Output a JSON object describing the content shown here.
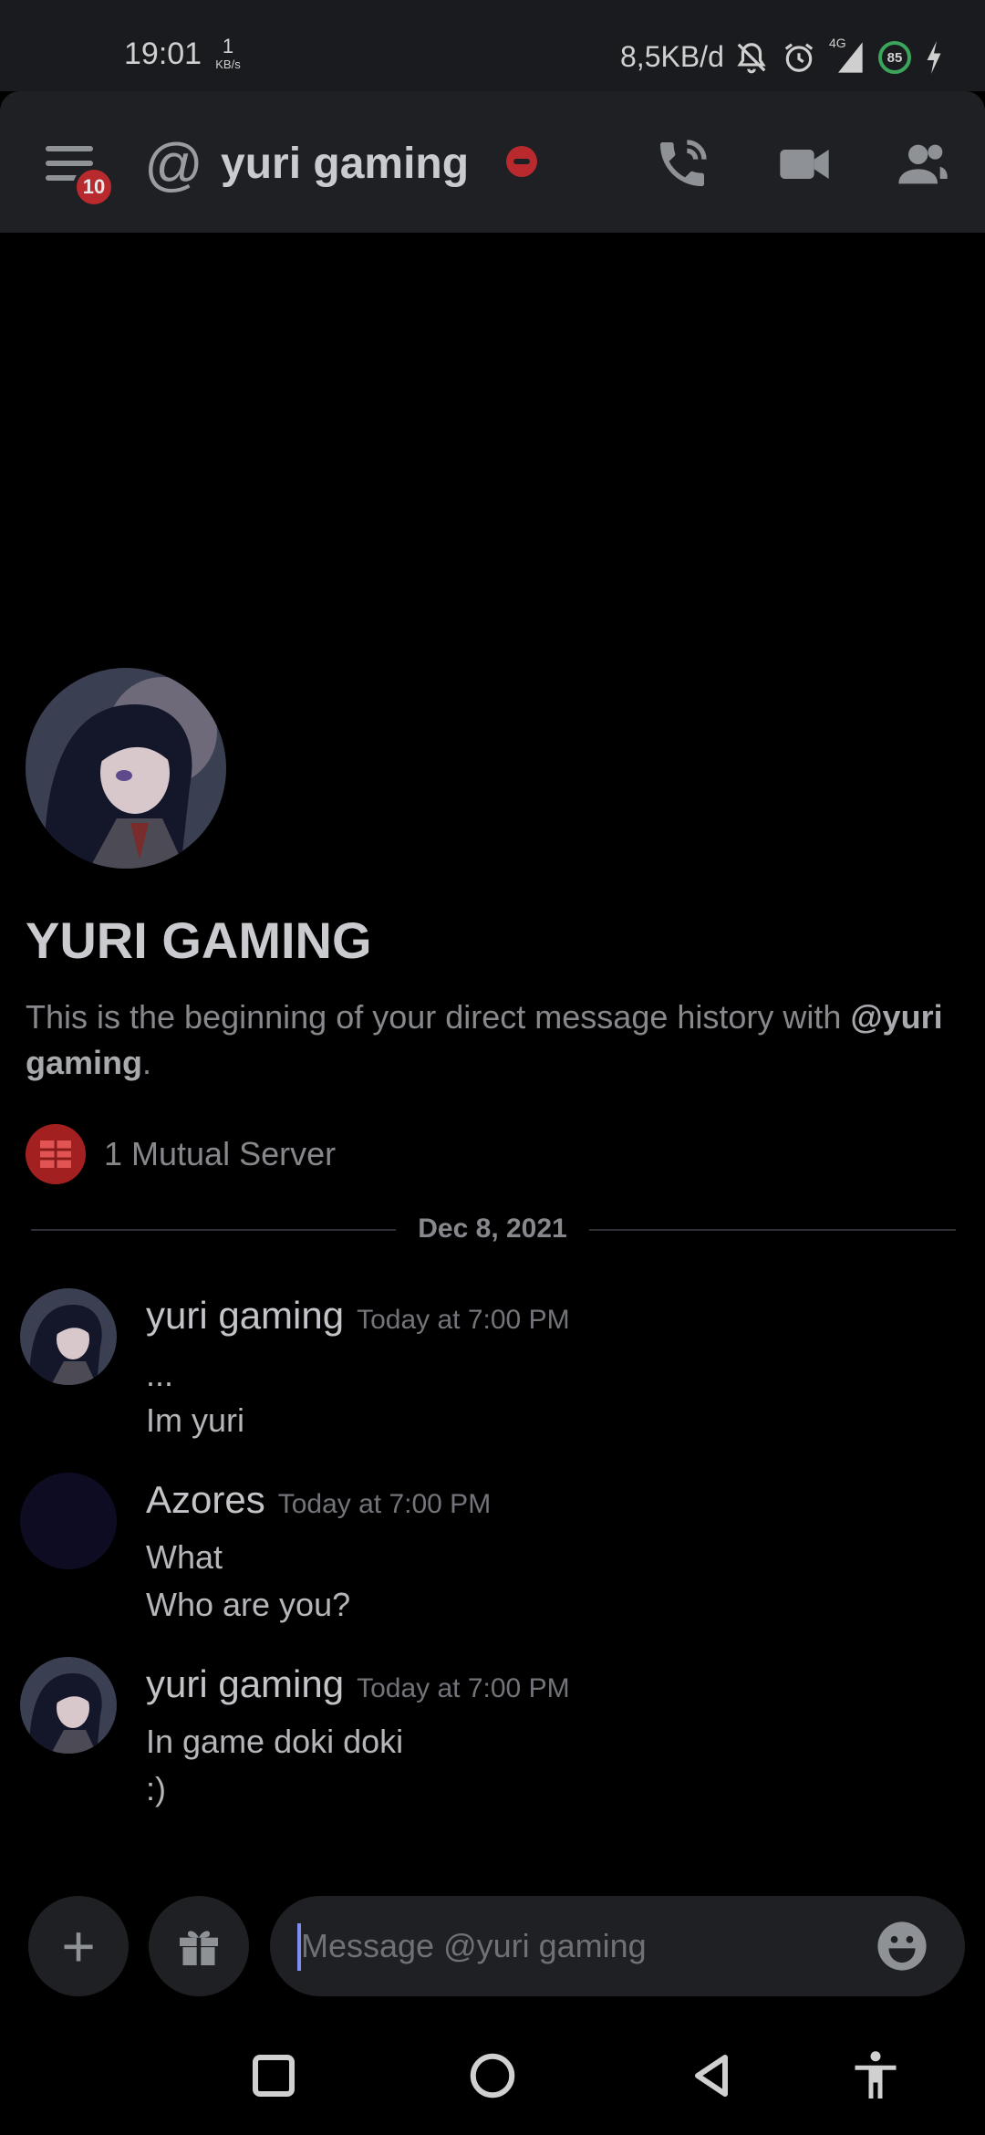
{
  "status_bar": {
    "time": "19:01",
    "speed_value": "1",
    "speed_unit": "KB/s",
    "network_rate": "8,5KB/d",
    "network_type": "4G",
    "battery": "85",
    "icons": [
      "bell-off-icon",
      "alarm-icon",
      "signal-icon",
      "battery-icon",
      "charging-icon"
    ]
  },
  "header": {
    "unread_badge": "10",
    "channel_name": "yuri gaming",
    "status": "do-not-disturb",
    "actions": [
      "call-icon",
      "video-icon",
      "members-icon"
    ]
  },
  "profile": {
    "display_name": "YURI GAMING",
    "intro_text": "This is the beginning of your direct message history with",
    "intro_mention": "@yuri gaming",
    "intro_end": ".",
    "mutual_servers": "1 Mutual Server"
  },
  "divider": {
    "date": "Dec 8, 2021"
  },
  "messages": [
    {
      "author": "yuri gaming",
      "time": "Today at 7:00 PM",
      "lines": [
        "...",
        "Im yuri"
      ]
    },
    {
      "author": "Azores",
      "time": "Today at 7:00 PM",
      "lines": [
        "What",
        "Who are you?"
      ]
    },
    {
      "author": "yuri gaming",
      "time": "Today at 7:00 PM",
      "lines": [
        "In game doki doki",
        ":)"
      ]
    }
  ],
  "composer": {
    "placeholder": "Message @yuri gaming",
    "value": ""
  },
  "colors": {
    "background": "#000000",
    "panel": "#1f2023",
    "dnd_red": "#b82a2e",
    "caret": "#7f8cf0"
  }
}
